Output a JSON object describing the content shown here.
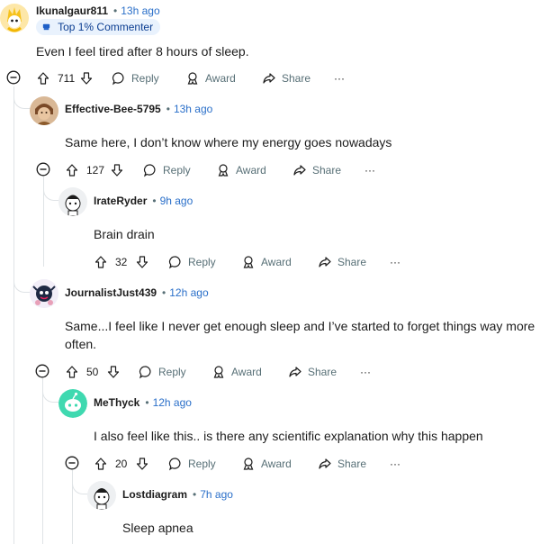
{
  "comments": [
    {
      "username": "Ikunalgaur811",
      "time": "13h ago",
      "badge": "Top 1% Commenter",
      "text": "Even I feel tired after 8 hours of sleep.",
      "votes": "711"
    },
    {
      "username": "Effective-Bee-5795",
      "time": "13h ago",
      "text": "Same here, I don’t know where my energy goes nowadays",
      "votes": "127"
    },
    {
      "username": "IrateRyder",
      "time": "9h ago",
      "text": "Brain drain",
      "votes": "32"
    },
    {
      "username": "JournalistJust439",
      "time": "12h ago",
      "text_line1": "Same...I feel like I never get enough sleep and I’ve started to forget things way more",
      "text_line2": "often.",
      "votes": "50"
    },
    {
      "username": "MeThyck",
      "time": "12h ago",
      "text": "I also feel like this.. is there any scientific explanation why this happen",
      "votes": "20"
    },
    {
      "username": "Lostdiagram",
      "time": "7h ago",
      "text": "Sleep apnea"
    }
  ],
  "labels": {
    "reply": "Reply",
    "award": "Award",
    "share": "Share",
    "more": "···",
    "separator": "•"
  },
  "icons": {
    "upvote": "arrow-up-icon",
    "downvote": "arrow-down-icon",
    "reply": "speech-bubble-icon",
    "award": "award-ribbon-icon",
    "share": "share-arrow-icon",
    "collapse": "minus-circle-icon",
    "badge": "trophy-badge-icon"
  },
  "colors": {
    "time": "#2a6fc9",
    "badge_bg": "#e9f2fd",
    "thread_line": "#dfe3e6",
    "meta_gray": "#576f76"
  }
}
